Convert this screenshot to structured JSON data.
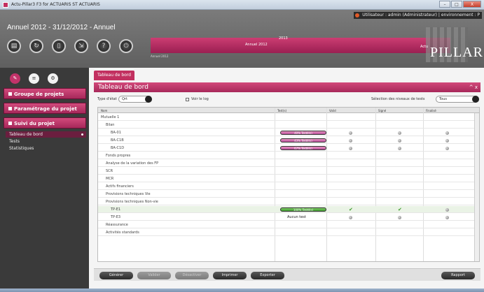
{
  "window": {
    "title": "Actu-Pillar3 F3 for ACTUARIS ST ACTUARIS",
    "minimize": "–",
    "maximize": "□",
    "close": "X"
  },
  "banner": {
    "user_line": "Utilisateur : admin (Administrateur) | environnement : P",
    "period": "Annuel 2012 - 31/12/2012 - Annuel",
    "timeline_label": "Annuel 2012",
    "timeline_year": "2013",
    "timeline_sub": "Annuel 2012",
    "logo_prefix": "Actu",
    "logo_name": "PILLAR3"
  },
  "toolbar_icons": [
    "document-icon",
    "refresh-icon",
    "phone-icon",
    "export-icon",
    "help-icon",
    "power-icon"
  ],
  "sidebar": {
    "nav": [
      {
        "label": "Groupe de projets"
      },
      {
        "label": "Paramétrage du projet"
      },
      {
        "label": "Suivi du projet"
      }
    ],
    "subitems": [
      "Tableau de bord",
      "Tests",
      "Statistiques"
    ]
  },
  "main": {
    "tab": "Tableau de bord",
    "panel_title": "Tableau de bord",
    "panel_controls": "^ x",
    "filters": {
      "type_label": "Type d'état",
      "type_value": "Qrt",
      "log_label": "Voir le log",
      "level_label": "Sélection des niveaux de tests",
      "level_value": "Tous"
    },
    "columns": [
      "Nom",
      "Test(s)",
      "Valid",
      "Signé",
      "Finalisé"
    ],
    "rows": [
      {
        "name": "Mutuelle 1",
        "indent": 0
      },
      {
        "name": "Bilan",
        "indent": 1
      },
      {
        "name": "BA-01",
        "indent": 2,
        "progress": "40% Testé(s)",
        "status": [
          "grey",
          "grey",
          "grey"
        ]
      },
      {
        "name": "BA-C1B",
        "indent": 2,
        "progress": "43% Testé(s)",
        "status": [
          "grey",
          "grey",
          "grey"
        ]
      },
      {
        "name": "BA-C1D",
        "indent": 2,
        "progress": "67% Testé(s)",
        "status": [
          "grey",
          "grey",
          "grey"
        ]
      },
      {
        "name": "Fonds propres",
        "indent": 1
      },
      {
        "name": "Analyse de la variation des FP",
        "indent": 1
      },
      {
        "name": "SCR",
        "indent": 1
      },
      {
        "name": "MCR",
        "indent": 1
      },
      {
        "name": "Actifs financiers",
        "indent": 1
      },
      {
        "name": "Provisions techniques Vie",
        "indent": 1
      },
      {
        "name": "Provisions techniques Non-vie",
        "indent": 1
      },
      {
        "name": "TP-E1",
        "indent": 2,
        "progress": "100% Testé(s)",
        "status": [
          "check",
          "check",
          "grey"
        ],
        "highlight": true
      },
      {
        "name": "TP-E3",
        "indent": 2,
        "no_result": "Aucun test",
        "status": [
          "grey",
          "grey",
          "grey"
        ]
      },
      {
        "name": "Réassurance",
        "indent": 1
      },
      {
        "name": "Activités standards",
        "indent": 1
      }
    ]
  },
  "footer": {
    "buttons": [
      "Générer",
      "Valider",
      "Désactiver",
      "Imprimer",
      "Exporter"
    ],
    "right_button": "Rapport"
  }
}
